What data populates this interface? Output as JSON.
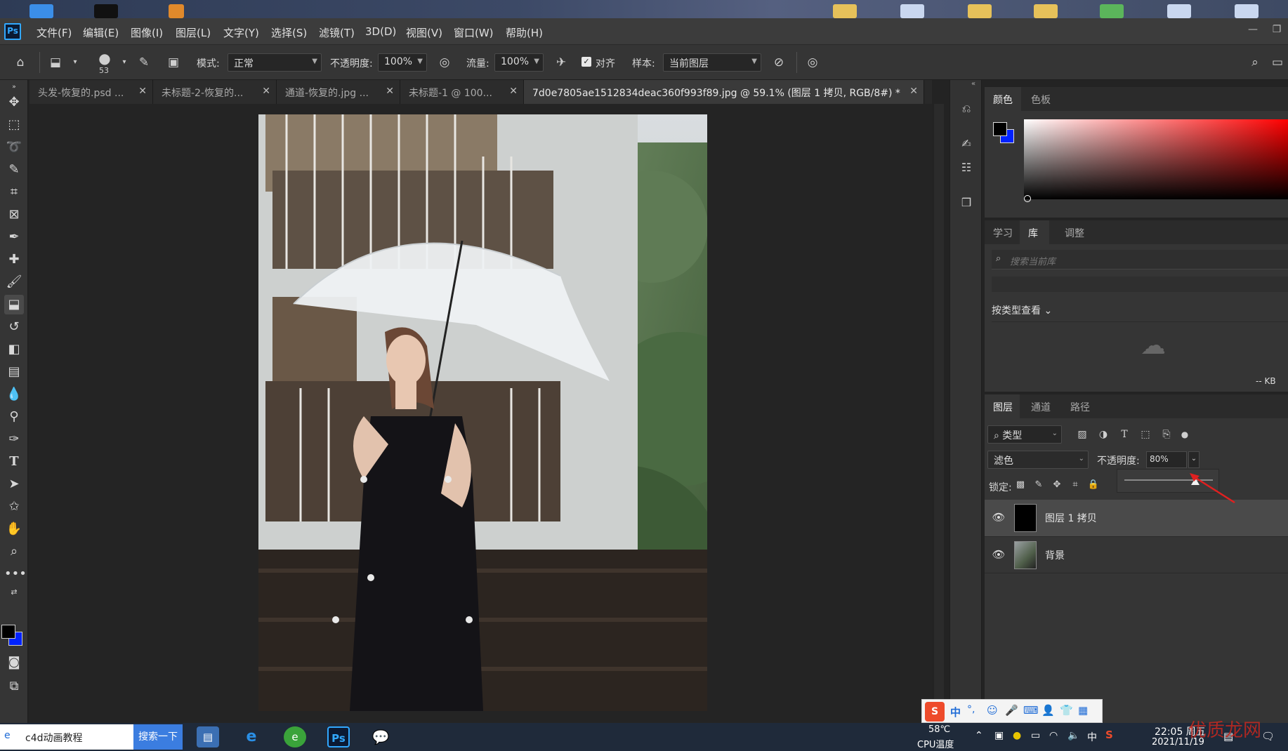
{
  "menubar": {
    "app_logo": "Ps",
    "items": [
      "文件(F)",
      "编辑(E)",
      "图像(I)",
      "图层(L)",
      "文字(Y)",
      "选择(S)",
      "滤镜(T)",
      "3D(D)",
      "视图(V)",
      "窗口(W)",
      "帮助(H)"
    ]
  },
  "options": {
    "brush_size": "53",
    "mode_label": "模式:",
    "mode_value": "正常",
    "opacity_label": "不透明度:",
    "opacity_value": "100%",
    "flow_label": "流量:",
    "flow_value": "100%",
    "align_label": "对齐",
    "align_checked": true,
    "sample_label": "样本:",
    "sample_value": "当前图层"
  },
  "tabs": [
    {
      "label": "头发-恢复的.psd ...",
      "active": false
    },
    {
      "label": "未标题-2-恢复的...",
      "active": false
    },
    {
      "label": "通道-恢复的.jpg ...",
      "active": false
    },
    {
      "label": "未标题-1 @ 100...",
      "active": false
    },
    {
      "label": "7d0e7805ae1512834deac360f993f89.jpg  @  59.1%  (图层 1 拷贝, RGB/8#) *",
      "active": true
    }
  ],
  "color_panel": {
    "tabs": [
      "颜色",
      "色板"
    ],
    "foreground": "#000000",
    "background": "#0022ff",
    "hue_color": "#ff0000"
  },
  "library_panel": {
    "tabs": [
      "学习",
      "库",
      "调整"
    ],
    "active_tab": "库",
    "search_placeholder": "搜索当前库",
    "view_by": "按类型查看",
    "size_text": "-- KB"
  },
  "layers_panel": {
    "tabs": [
      "图层",
      "通道",
      "路径"
    ],
    "filter_label": "类型",
    "blend_mode": "滤色",
    "opacity_label": "不透明度:",
    "opacity_value": "80%",
    "opacity_fraction": 0.8,
    "lock_label": "锁定:",
    "layers": [
      {
        "name": "图层 1 拷贝",
        "selected": true
      },
      {
        "name": "背景",
        "selected": false
      }
    ]
  },
  "ime_bar": {
    "lang": "中"
  },
  "taskbar": {
    "search_text": "c4d动画教程",
    "search_button": "搜索一下",
    "temp": "58℃",
    "temp_label": "CPU温度",
    "time": "22:05 周五",
    "date": "2021/11/19",
    "tray_lang": "中"
  },
  "watermark": "优质龙网"
}
